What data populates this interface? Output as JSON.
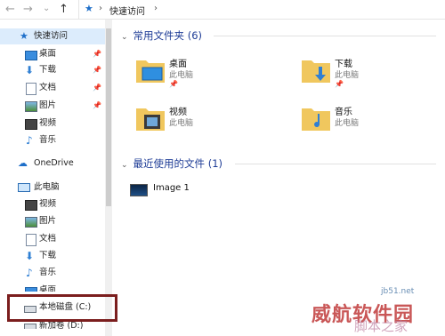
{
  "toolbar": {
    "back": "←",
    "forward": "→",
    "recent": "⌄",
    "up": "↑"
  },
  "address": {
    "separator_1": "›",
    "crumb": "快速访问",
    "separator_2": "›"
  },
  "sidebar": {
    "quick_access": "快速访问",
    "quick_items": [
      {
        "label": "桌面",
        "pin": "📌"
      },
      {
        "label": "下载",
        "pin": "📌"
      },
      {
        "label": "文档",
        "pin": "📌"
      },
      {
        "label": "图片",
        "pin": "📌"
      },
      {
        "label": "视频"
      },
      {
        "label": "音乐"
      }
    ],
    "onedrive": "OneDrive",
    "this_pc": "此电脑",
    "pc_items": [
      {
        "label": "视频"
      },
      {
        "label": "图片"
      },
      {
        "label": "文档"
      },
      {
        "label": "下载"
      },
      {
        "label": "音乐"
      },
      {
        "label": "桌面"
      }
    ],
    "local_disk": "本地磁盘 (C:)",
    "new_volume": "新加卷 (D:)"
  },
  "main": {
    "frequent_header": "常用文件夹 (6)",
    "folders": [
      {
        "name": "桌面",
        "location": "此电脑",
        "pinned": "📌"
      },
      {
        "name": "下载",
        "location": "此电脑",
        "pinned": "📌"
      },
      {
        "name": "视频",
        "location": "此电脑"
      },
      {
        "name": "音乐",
        "location": "此电脑"
      }
    ],
    "recent_header": "最近使用的文件 (1)",
    "recent_files": [
      {
        "name": "Image 1"
      }
    ]
  },
  "watermark": {
    "line1": "威航软件园",
    "line2": "脚本之家",
    "url": "jb51.net"
  },
  "colors": {
    "accent": "#1e6fc9",
    "group_header": "#1e3c96",
    "highlight_box": "#7b1e1e",
    "folder": "#f0c75e"
  }
}
